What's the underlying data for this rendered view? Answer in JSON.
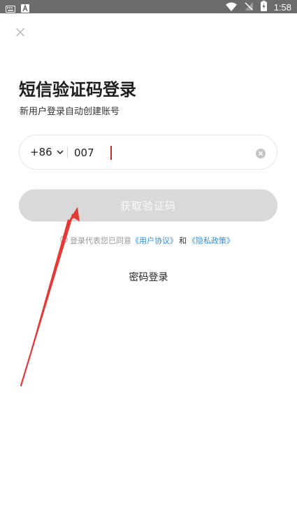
{
  "status_bar": {
    "time": "1:58",
    "left_icons": [
      "keyboard-icon",
      "app-a-icon"
    ],
    "right_icons": [
      "wifi-icon",
      "no-signal-icon",
      "battery-charging-icon"
    ]
  },
  "header": {
    "close_icon": "close-icon"
  },
  "login": {
    "title": "短信验证码登录",
    "subtitle": "新用户登录自动创建账号",
    "country_code": "+86",
    "phone_value": "007",
    "get_code_label": "获取验证码",
    "agreement_prefix": "登录代表您已同意",
    "user_agreement": "《用户协议》",
    "and": "和",
    "privacy_policy": "《隐私政策》",
    "password_login": "密码登录"
  },
  "colors": {
    "status_bar": "#6b6b6b",
    "button_disabled": "#d9d9d9",
    "link": "#2f8de4",
    "cursor": "#e02020",
    "annotation_arrow": "#e53935"
  }
}
